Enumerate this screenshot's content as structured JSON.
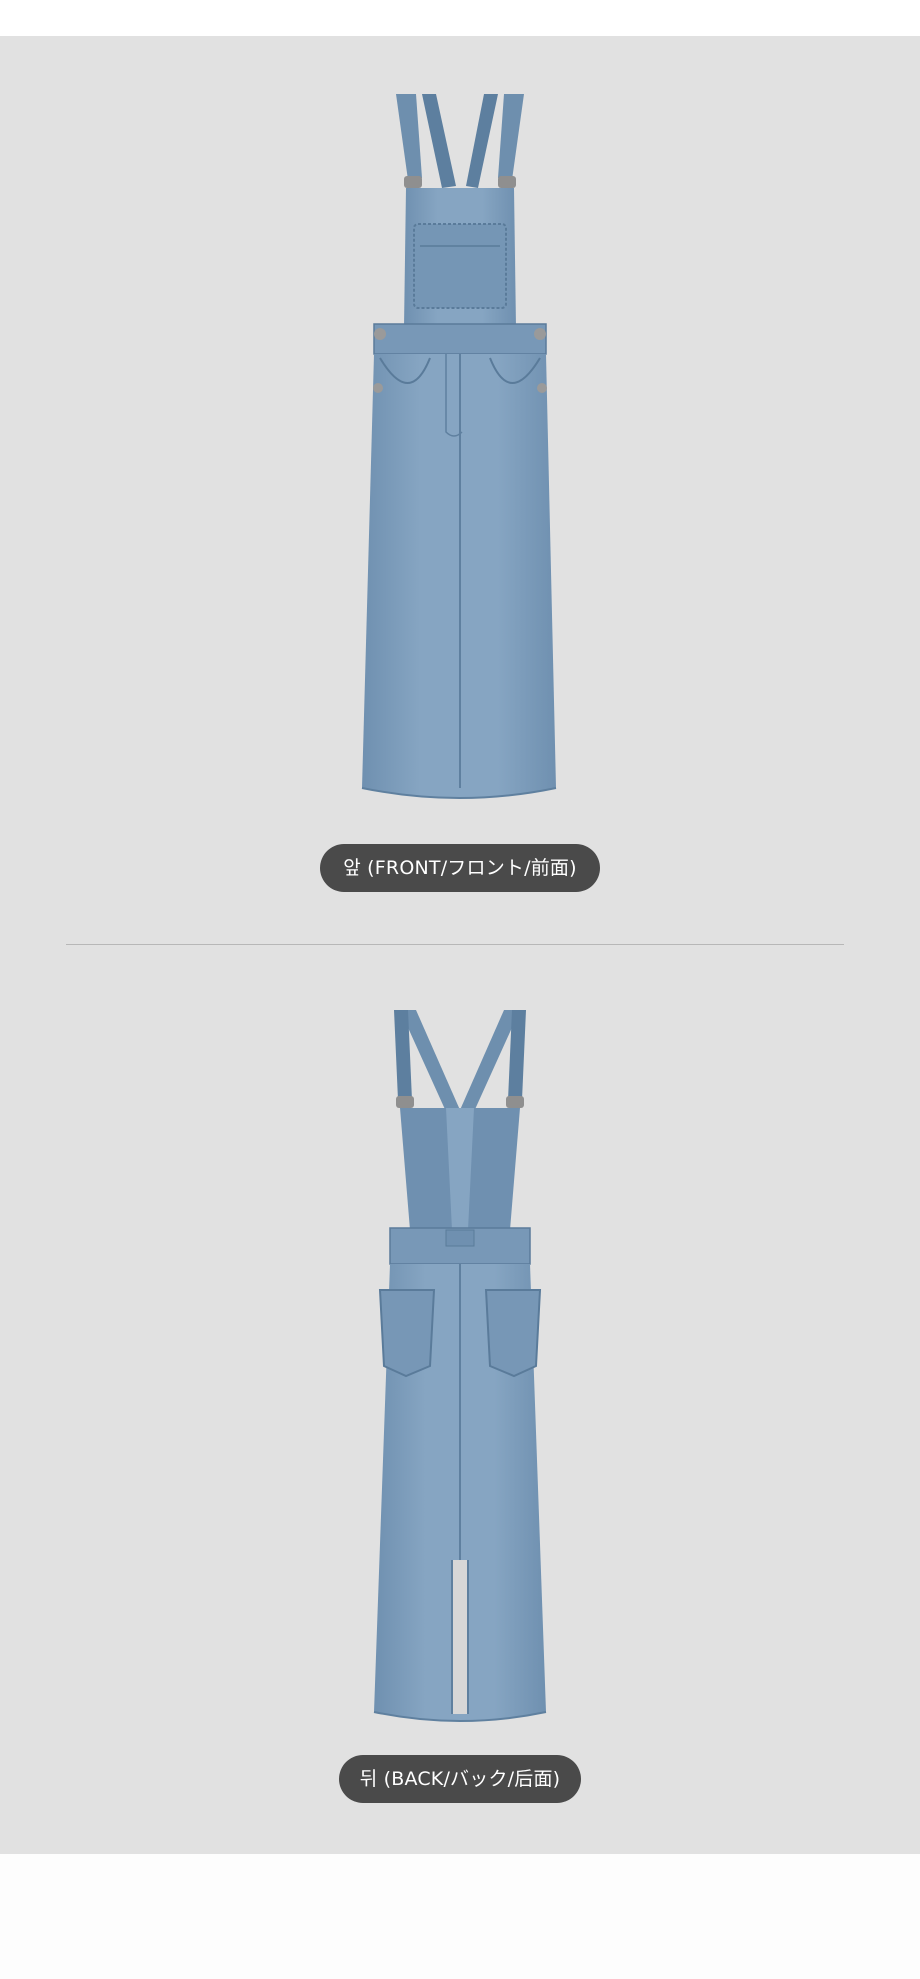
{
  "colors": {
    "panel_background": "#e1e1e1",
    "page_background": "#ffffff",
    "label_background": "#4a4a4a",
    "label_text": "#ffffff",
    "denim": "#7f9fbd",
    "denim_shadow": "#6d8eae",
    "divider": "#b7b7b7"
  },
  "sections": [
    {
      "view": "front",
      "image": "denim-overall-dress-front",
      "label": "앞 (FRONT/フロント/前面)"
    },
    {
      "view": "back",
      "image": "denim-overall-dress-back",
      "label": "뒤 (BACK/バック/后面)"
    }
  ]
}
